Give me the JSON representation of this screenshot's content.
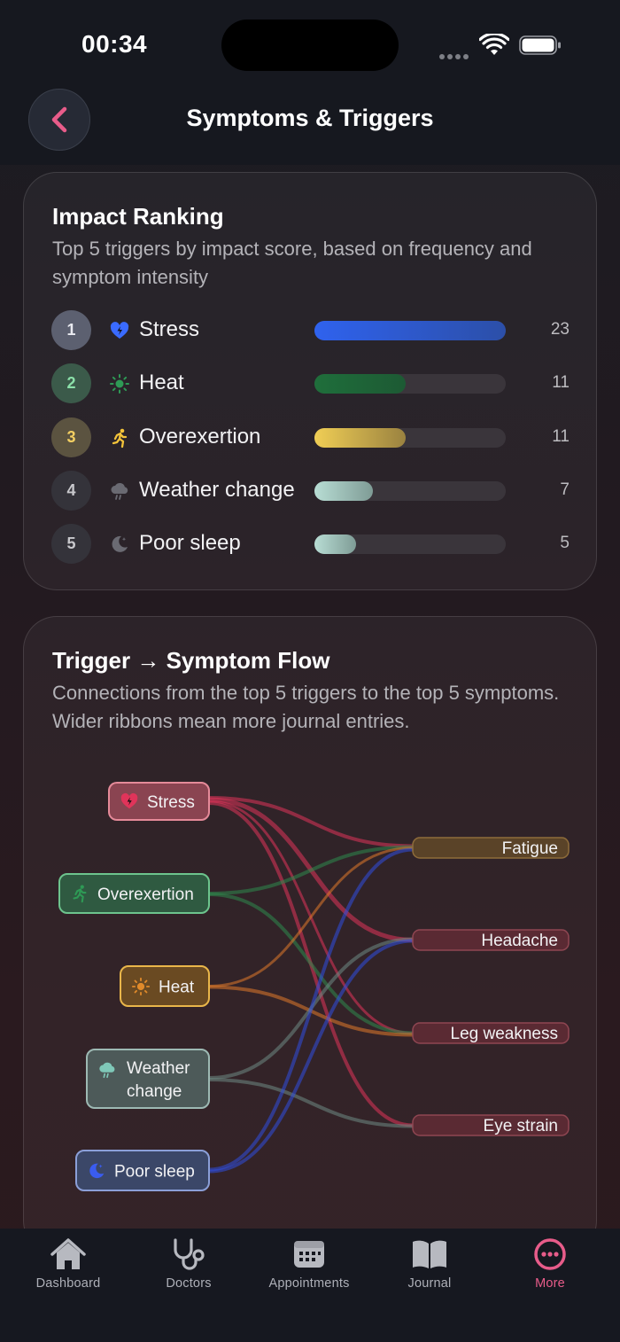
{
  "status_bar": {
    "time": "00:34"
  },
  "header": {
    "title": "Symptoms & Triggers"
  },
  "impact_ranking": {
    "title": "Impact Ranking",
    "subtitle": "Top 5 triggers by impact score, based on frequency and symptom intensity",
    "items": [
      {
        "rank": "1",
        "label": "Stress",
        "icon": "heart-bolt-icon",
        "value": "23",
        "fraction": 1.0,
        "color": "#2f5fe0",
        "badge_bg": "#5c6070",
        "badge_fg": "#e9eaf0"
      },
      {
        "rank": "2",
        "label": "Heat",
        "icon": "sun-icon",
        "value": "11",
        "fraction": 0.478,
        "color": "#1f6b3a",
        "badge_bg": "#3b5a4a",
        "badge_fg": "#8be0a9"
      },
      {
        "rank": "3",
        "label": "Overexertion",
        "icon": "runner-icon",
        "value": "11",
        "fraction": 0.478,
        "color": "#e0c04a",
        "badge_bg": "#5b5340",
        "badge_fg": "#f3cf62"
      },
      {
        "rank": "4",
        "label": "Weather change",
        "icon": "cloud-rain-icon",
        "value": "7",
        "fraction": 0.304,
        "color": "#a8cfc4",
        "badge_bg": "#34333a",
        "badge_fg": "#c8c8cc"
      },
      {
        "rank": "5",
        "label": "Poor sleep",
        "icon": "moon-icon",
        "value": "5",
        "fraction": 0.217,
        "color": "#a8cfc4",
        "badge_bg": "#34333a",
        "badge_fg": "#c8c8cc"
      }
    ]
  },
  "flow": {
    "title": "Trigger → Symptom Flow",
    "subtitle": "Connections from the top 5 triggers to the top 5 symptoms. Wider ribbons mean more journal entries.",
    "triggers": [
      {
        "label": "Stress",
        "icon": "heart-bolt-icon",
        "color": "#e0345a"
      },
      {
        "label": "Overexertion",
        "icon": "runner-icon",
        "color": "#2e8a4c"
      },
      {
        "label": "Heat",
        "icon": "sun-icon",
        "color": "#e08a2a"
      },
      {
        "label_line1": "Weather",
        "label_line2": "change",
        "icon": "cloud-rain-icon",
        "color": "#6e8f88"
      },
      {
        "label": "Poor sleep",
        "icon": "moon-icon",
        "color": "#2f4fe0"
      }
    ],
    "symptoms": [
      {
        "label": "Fatigue"
      },
      {
        "label": "Headache"
      },
      {
        "label": "Leg weakness"
      },
      {
        "label": "Eye strain"
      }
    ]
  },
  "tabs": [
    {
      "label": "Dashboard",
      "icon": "house-icon"
    },
    {
      "label": "Doctors",
      "icon": "stethoscope-icon"
    },
    {
      "label": "Appointments",
      "icon": "calendar-icon"
    },
    {
      "label": "Journal",
      "icon": "book-icon"
    },
    {
      "label": "More",
      "icon": "more-icon",
      "active": true
    }
  ],
  "colors": {
    "accent": "#e85c8a",
    "background": "#1b1c22"
  }
}
